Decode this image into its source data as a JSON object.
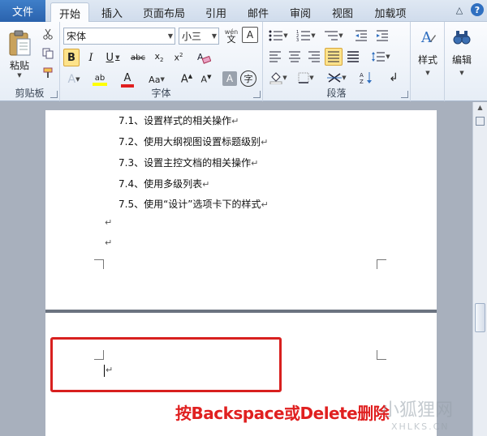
{
  "tabs": {
    "file": "文件",
    "items": [
      {
        "label": "开始",
        "active": true
      },
      {
        "label": "插入"
      },
      {
        "label": "页面布局"
      },
      {
        "label": "引用"
      },
      {
        "label": "邮件"
      },
      {
        "label": "审阅"
      },
      {
        "label": "视图"
      },
      {
        "label": "加载项"
      }
    ]
  },
  "ribbon": {
    "clipboard": {
      "label": "剪贴板",
      "paste": "粘贴"
    },
    "font": {
      "label": "字体",
      "font_name": "宋体",
      "font_size": "小三"
    },
    "paragraph": {
      "label": "段落"
    },
    "styles": {
      "label": "样式"
    },
    "editing": {
      "label": "编辑"
    }
  },
  "document": {
    "toc_lines": [
      "7.1、设置样式的相关操作",
      "7.2、使用大纲视图设置标题级别",
      "7.3、设置主控文档的相关操作",
      "7.4、使用多级列表",
      "7.5、使用“设计”选项卡下的样式"
    ],
    "paragraph_mark": "↵"
  },
  "annotation": "按Backspace或Delete删除",
  "watermark": {
    "cn": "小狐狸网",
    "en": "XHLKS.CN"
  },
  "colors": {
    "file_tab": "#2a62ad",
    "highlight_border": "#d8201f",
    "annotation_text": "#e02020",
    "font_color_swatch": "#e02020",
    "highlight_swatch": "#ffff00"
  }
}
